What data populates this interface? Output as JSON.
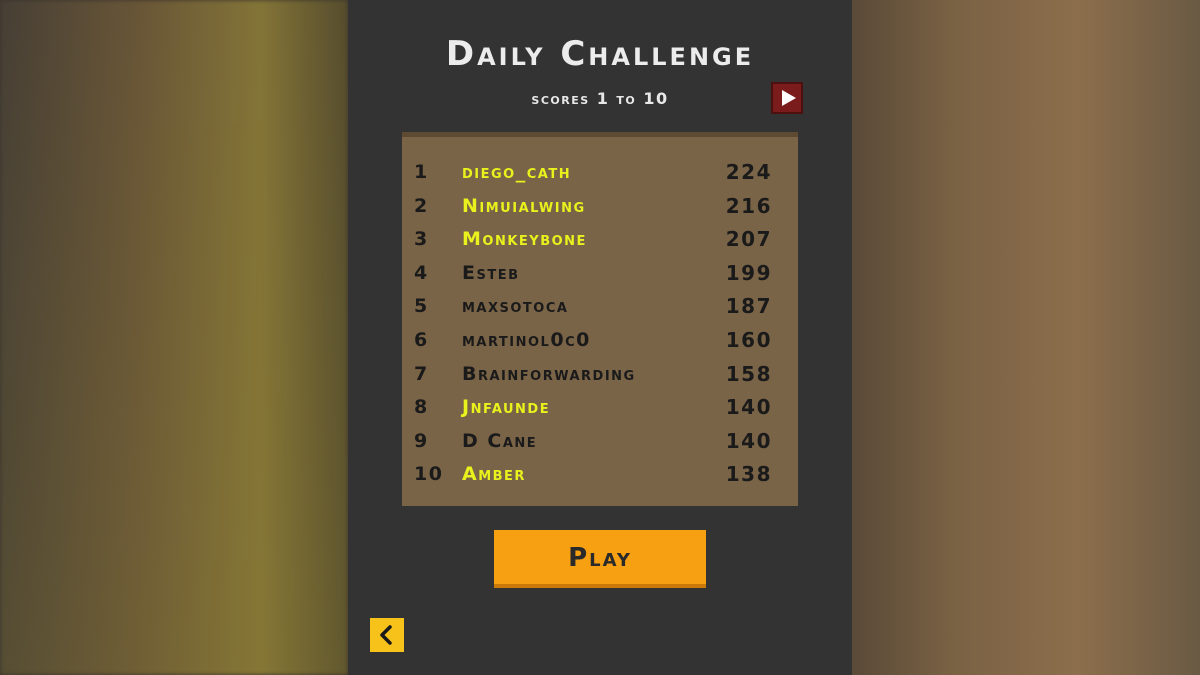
{
  "header": {
    "title": "Daily Challenge",
    "subtitle": "scores 1 to 10"
  },
  "leaderboard": {
    "rows": [
      {
        "rank": "1",
        "name": "diego_cath",
        "score": "224",
        "highlight": true
      },
      {
        "rank": "2",
        "name": "Nimuialwing",
        "score": "216",
        "highlight": true
      },
      {
        "rank": "3",
        "name": "Monkeybone",
        "score": "207",
        "highlight": true
      },
      {
        "rank": "4",
        "name": "Esteb",
        "score": "199",
        "highlight": false
      },
      {
        "rank": "5",
        "name": "maxsotoca",
        "score": "187",
        "highlight": false
      },
      {
        "rank": "6",
        "name": "martinol0c0",
        "score": "160",
        "highlight": false
      },
      {
        "rank": "7",
        "name": "Brainforwarding",
        "score": "158",
        "highlight": false
      },
      {
        "rank": "8",
        "name": "Jnfaunde",
        "score": "140",
        "highlight": true
      },
      {
        "rank": "9",
        "name": "D Cane",
        "score": "140",
        "highlight": false
      },
      {
        "rank": "10",
        "name": "Amber",
        "score": "138",
        "highlight": true
      }
    ]
  },
  "buttons": {
    "play_label": "Play",
    "next_icon": "play-triangle-icon",
    "back_icon": "chevron-left-icon"
  },
  "colors": {
    "panel": "#333333",
    "board": "#7a6447",
    "highlight_name": "#e8f21c",
    "play_button": "#f7a012",
    "next_button": "#7a1c1c",
    "back_button": "#f7c21a"
  }
}
